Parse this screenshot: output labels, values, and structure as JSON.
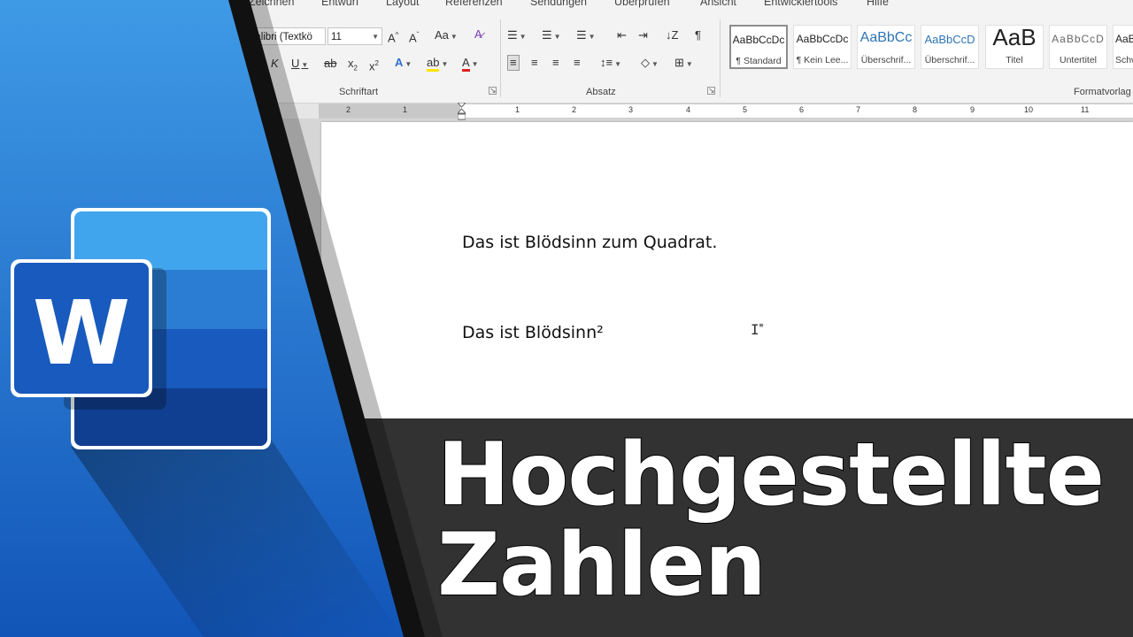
{
  "ribbon": {
    "tabs": [
      "Zeichnen",
      "Entwurf",
      "Layout",
      "Referenzen",
      "Sendungen",
      "Überprüfen",
      "Ansicht",
      "Entwicklertools",
      "Hilfe"
    ],
    "font_name": "Calibri (Textkö",
    "font_size": "11",
    "groups": {
      "schriftart": "Schriftart",
      "absatz": "Absatz",
      "formatvorlagen": "Formatvorlag"
    },
    "styles": [
      {
        "sample": "AaBbCcDc",
        "name": "¶ Standard"
      },
      {
        "sample": "AaBbCcDc",
        "name": "¶ Kein Lee..."
      },
      {
        "sample": "AaBbCc",
        "name": "Überschrif..."
      },
      {
        "sample": "AaBbCcD",
        "name": "Überschrif..."
      },
      {
        "sample": "AaB",
        "name": "Titel"
      },
      {
        "sample": "AaBbCcD",
        "name": "Untertitel"
      },
      {
        "sample": "AaB",
        "name": "Schw"
      }
    ],
    "icons": {
      "grow": "A^",
      "shrink": "Aˇ",
      "case": "Aa",
      "clear": "A",
      "italic": "K",
      "underline": "U",
      "strike": "ab",
      "sub": "x₂",
      "sup": "x²",
      "pilcrow": "¶"
    }
  },
  "ruler": {
    "labels": [
      "2",
      "1",
      "1",
      "2",
      "3",
      "4",
      "5",
      "6",
      "7",
      "8",
      "9",
      "10",
      "11"
    ]
  },
  "document": {
    "line1": "Das ist Blödsinn zum Quadrat.",
    "line2": "Das ist Blödsinn²"
  },
  "banner": {
    "line1": "Hochgestellte",
    "line2": "Zahlen"
  },
  "logo": {
    "letter": "W"
  },
  "colors": {
    "blue_dark": "#1a4fa3",
    "blue_light": "#41a5ee",
    "banner": "#323232"
  }
}
